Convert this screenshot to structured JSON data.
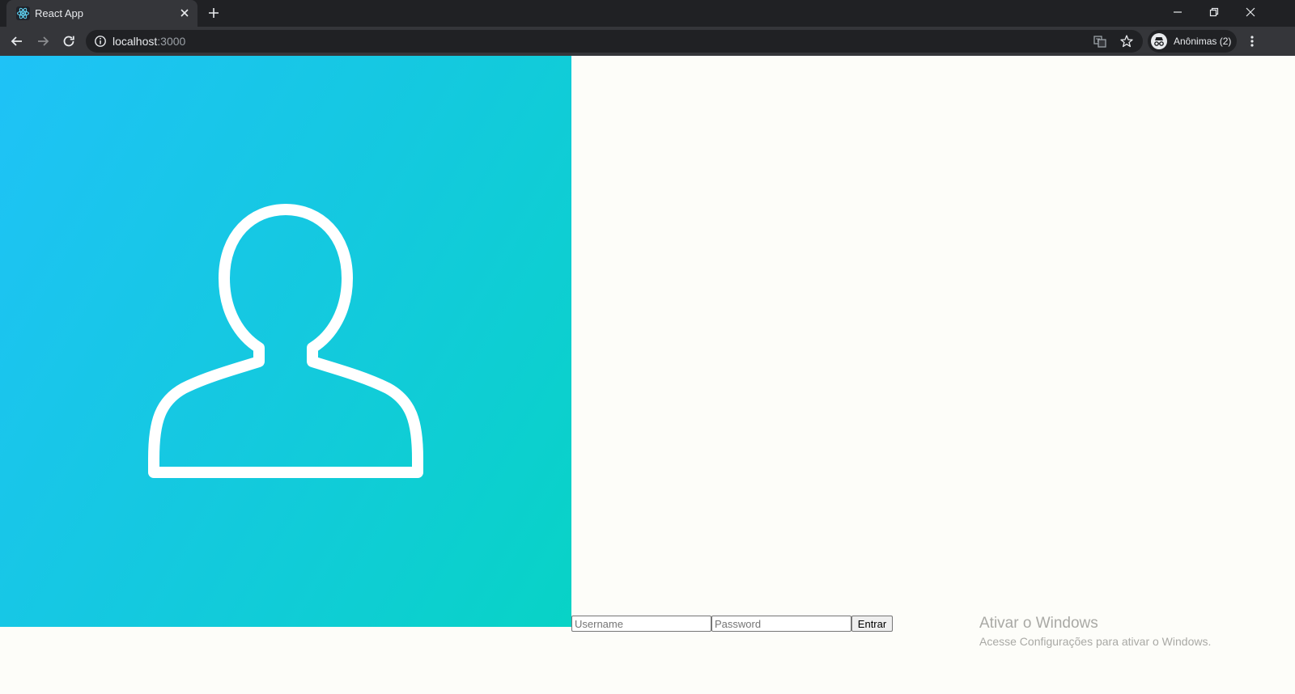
{
  "browser": {
    "tab_title": "React App",
    "url_host": "localhost",
    "url_port": ":3000",
    "profile_label": "Anônimas (2)",
    "icons": [
      "react-favicon-icon",
      "tab-close-icon",
      "new-tab-icon",
      "minimize-icon",
      "restore-icon",
      "close-window-icon",
      "back-icon",
      "forward-icon",
      "reload-icon",
      "info-icon",
      "translate-icon",
      "bookmark-star-icon",
      "incognito-icon",
      "menu-icon"
    ]
  },
  "hero": {
    "gradient_colors": [
      "#1fc2f7",
      "#08d3c6"
    ],
    "illustration": "user-silhouette-icon"
  },
  "login": {
    "username_placeholder": "Username",
    "password_placeholder": "Password",
    "submit_label": "Entrar"
  },
  "watermark": {
    "title": "Ativar o Windows",
    "subtitle": "Acesse Configurações para ativar o Windows."
  }
}
